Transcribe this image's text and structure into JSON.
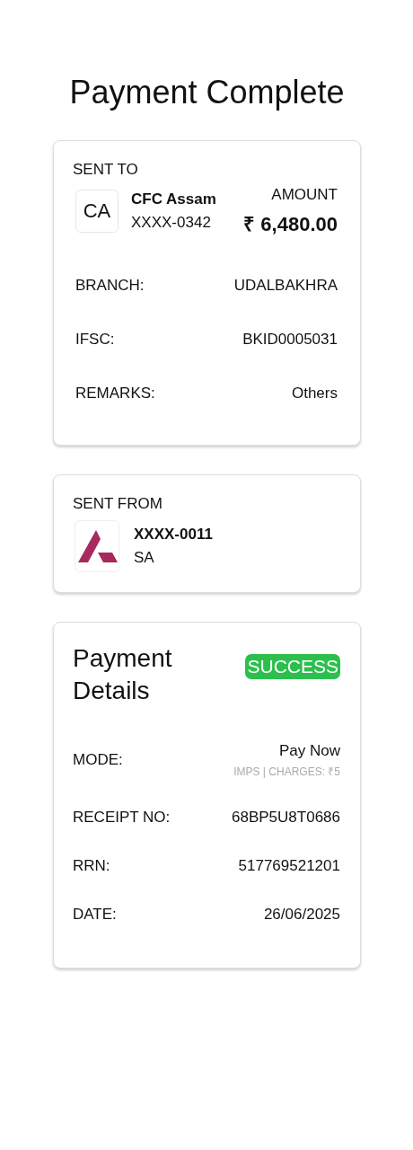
{
  "title": "Payment Complete",
  "sent_to": {
    "heading": "SENT TO",
    "initials": "CA",
    "name": "CFC Assam",
    "account": "XXXX-0342",
    "amount_label": "AMOUNT",
    "amount": "₹ 6,480.00",
    "rows": [
      {
        "label": "BRANCH:",
        "value": "UDALBAKHRA"
      },
      {
        "label": "IFSC:",
        "value": "BKID0005031"
      },
      {
        "label": "REMARKS:",
        "value": "Others"
      }
    ]
  },
  "sent_from": {
    "heading": "SENT FROM",
    "account": "XXXX-0011",
    "type": "SA"
  },
  "payment_details": {
    "title": "Payment Details",
    "status": "SUCCESS",
    "color": "#2dbf4e",
    "rows": [
      {
        "label": "MODE:",
        "value": "Pay Now",
        "note": "IMPS | CHARGES: ₹5"
      },
      {
        "label": "RECEIPT NO:",
        "value": "68BP5U8T0686"
      },
      {
        "label": "RRN:",
        "value": "517769521201"
      },
      {
        "label": "DATE:",
        "value": "26/06/2025"
      }
    ]
  }
}
